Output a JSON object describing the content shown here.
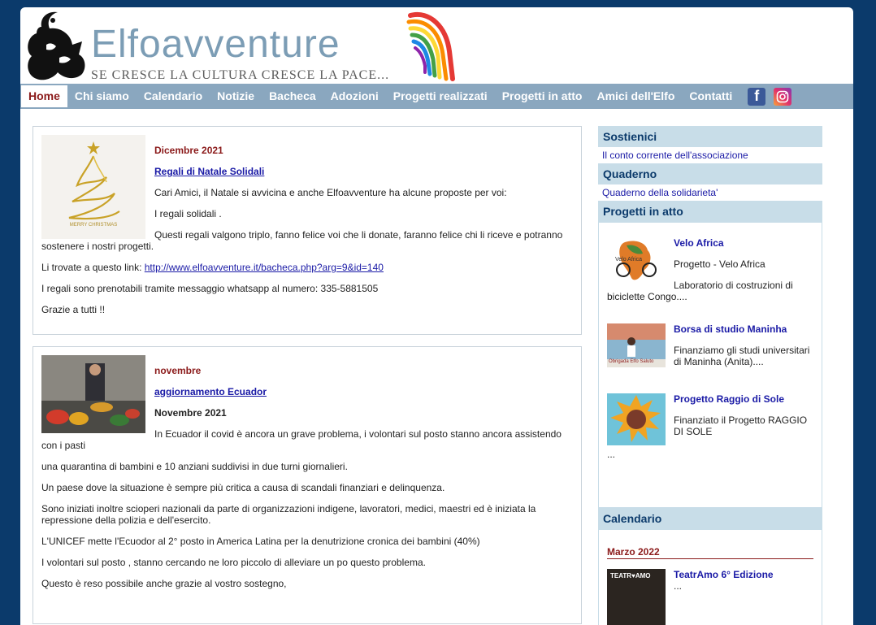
{
  "header": {
    "title": "Elfoavventure",
    "tagline": "SE CRESCE LA CULTURA CRESCE LA PACE..."
  },
  "nav": {
    "items": [
      "Home",
      "Chi siamo",
      "Calendario",
      "Notizie",
      "Bacheca",
      "Adozioni",
      "Progetti realizzati",
      "Progetti in atto",
      "Amici dell'Elfo",
      "Contatti"
    ],
    "facebook_glyph": "f"
  },
  "posts": [
    {
      "date": "Dicembre 2021",
      "title": "Regali di Natale Solidali",
      "thumb_caption": "MERRY CHRISTMAS",
      "p1": "Cari Amici, il Natale si avvicina e anche Elfoavventure ha alcune proposte per voi:",
      "p2": "I regali solidali .",
      "p3a": "Questi regali valgono triplo, fanno felice voi che li donate, faranno felice chi li riceve e potranno",
      "p3b": "sostenere i nostri progetti.",
      "p4_prefix": "Li trovate a questo link: ",
      "p4_link": "http://www.elfoavventure.it/bacheca.php?arg=9&id=140",
      "p5": "I regali sono prenotabili tramite messaggio whatsapp al numero: 335-5881505",
      "p6": "Grazie a tutti !!"
    },
    {
      "date": "novembre",
      "title": "aggiornamento Ecuador",
      "subtitle": "Novembre 2021",
      "p1a": "In Ecuador il covid è ancora un grave problema, i volontari sul posto stanno ancora assistendo",
      "p1b": "con i pasti",
      "p2": "una quarantina di bambini  e 10 anziani suddivisi in due turni giornalieri.",
      "p3": "Un paese dove la situazione è sempre più critica a causa di scandali finanziari e delinquenza.",
      "p4a": "Sono iniziati inoltre scioperi  nazionali da parte di organizzazioni indigene, lavoratori, medici, maestri ed è iniziata la",
      "p4b": "repressione della polizia e dell'esercito.",
      "p5": "L'UNICEF mette l'Ecuodor al 2° posto in America Latina per la denutrizione cronica dei bambini (40%)",
      "p6": "I volontari sul posto , stanno cercando ne loro piccolo di alleviare un po questo problema.",
      "p7": "Questo è reso possibile anche grazie al vostro sostegno,"
    }
  ],
  "sidebar": {
    "sostienici": {
      "head": "Sostienici",
      "link": "Il conto corrente dell'associazione"
    },
    "quaderno": {
      "head": "Quaderno",
      "link": "Quaderno della solidarieta'"
    },
    "progetti": {
      "head": "Progetti in atto",
      "items": [
        {
          "title": "Velo Africa",
          "l1": "Progetto - Velo Africa",
          "l2": "Laboratorio di costruzioni di",
          "l3": "biciclette Congo....",
          "thumb_text": "Velo Africa"
        },
        {
          "title": "Borsa di studio Maninha",
          "l1": "Finanziamo gli studi universitari",
          "l2": "di Maninha (Anita)....",
          "thumb_text": "Obrigada Elfo Saluto"
        },
        {
          "title": "Progetto Raggio di Sole",
          "l1": "Finanziato il Progetto RAGGIO",
          "l2": "DI SOLE",
          "l3": "..."
        }
      ]
    },
    "calendario": {
      "head": "Calendario",
      "month": "Marzo 2022",
      "event_title": "TeatrAmo 6° Edizione",
      "event_desc": "...",
      "thumb_text": "TEATR♥AMO"
    }
  }
}
